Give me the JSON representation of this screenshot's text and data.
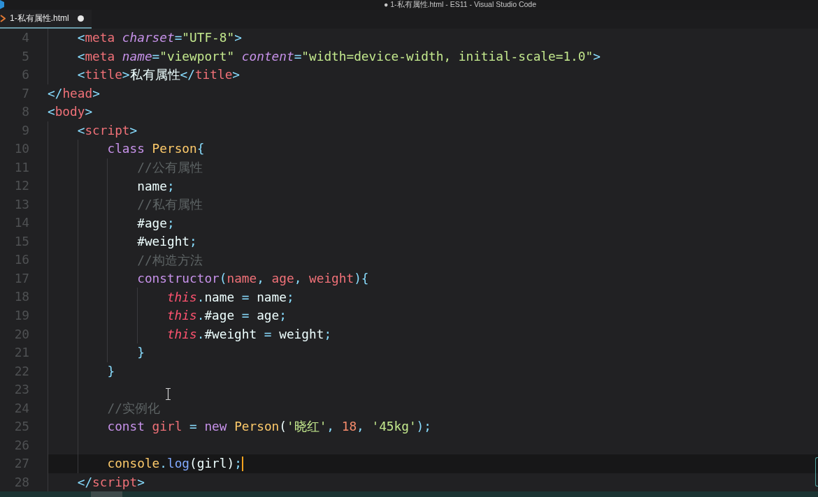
{
  "window": {
    "title": "● 1-私有属性.html - ES11 - Visual Studio Code"
  },
  "tab": {
    "label": "1-私有属性.html",
    "selected": true,
    "modified": true
  },
  "editor": {
    "lines": [
      {
        "children": [
          {
            "number": "4",
            "active": false,
            "tokens": [
              {
                "text": "<",
                "kind": "punct"
              },
              {
                "text": "meta ",
                "kind": "tag"
              },
              {
                "text": "charset",
                "kind": "attr"
              },
              {
                "text": "=",
                "kind": "punct"
              },
              {
                "text": "\"UTF-8\"",
                "kind": "string"
              },
              {
                "text": ">",
                "kind": "punct"
              }
            ]
          },
          {
            "number": "5",
            "active": false,
            "tokens": [
              {
                "text": "<",
                "kind": "punct"
              },
              {
                "text": "meta ",
                "kind": "tag"
              },
              {
                "text": "name",
                "kind": "attr"
              },
              {
                "text": "=",
                "kind": "punct"
              },
              {
                "text": "\"viewport\" ",
                "kind": "string"
              },
              {
                "text": "content",
                "kind": "attr"
              },
              {
                "text": "=",
                "kind": "punct"
              },
              {
                "text": "\"width=device-width, initial-scale=1.0\"",
                "kind": "string"
              },
              {
                "text": ">",
                "kind": "punct"
              }
            ]
          },
          {
            "number": "6",
            "active": false,
            "tokens": [
              {
                "text": "<",
                "kind": "punct"
              },
              {
                "text": "title",
                "kind": "tag"
              },
              {
                "text": ">",
                "kind": "punct"
              },
              {
                "text": "私有属性",
                "kind": "text"
              },
              {
                "text": "</",
                "kind": "punct"
              },
              {
                "text": "title",
                "kind": "tag"
              },
              {
                "text": ">",
                "kind": "punct"
              }
            ]
          }
        ]
      },
      {
        "number": "7",
        "active": false,
        "tokens": [
          {
            "text": "</",
            "kind": "punct"
          },
          {
            "text": "head",
            "kind": "tag"
          },
          {
            "text": ">",
            "kind": "punct"
          }
        ]
      },
      {
        "number": "8",
        "active": false,
        "tokens": [
          {
            "text": "<",
            "kind": "punct"
          },
          {
            "text": "body",
            "kind": "tag"
          },
          {
            "text": ">",
            "kind": "punct"
          }
        ],
        "children": [
          {
            "number": "9",
            "active": false,
            "tokens": [
              {
                "text": "<",
                "kind": "punct"
              },
              {
                "text": "script",
                "kind": "tag"
              },
              {
                "text": ">",
                "kind": "punct"
              }
            ],
            "children": [
              {
                "number": "10",
                "active": false,
                "tokens": [
                  {
                    "text": "class ",
                    "kind": "keyword"
                  },
                  {
                    "text": "Person",
                    "kind": "class"
                  },
                  {
                    "text": "{",
                    "kind": "punct"
                  }
                ],
                "children": [
                  {
                    "number": "11",
                    "active": false,
                    "tokens": [
                      {
                        "text": "//公有属性",
                        "kind": "comment"
                      }
                    ]
                  },
                  {
                    "number": "12",
                    "active": false,
                    "tokens": [
                      {
                        "text": "name",
                        "kind": "plain"
                      },
                      {
                        "text": ";",
                        "kind": "punct"
                      }
                    ]
                  },
                  {
                    "number": "13",
                    "active": false,
                    "tokens": [
                      {
                        "text": "//私有属性",
                        "kind": "comment"
                      }
                    ]
                  },
                  {
                    "number": "14",
                    "active": false,
                    "tokens": [
                      {
                        "text": "#age",
                        "kind": "plain"
                      },
                      {
                        "text": ";",
                        "kind": "punct"
                      }
                    ]
                  },
                  {
                    "number": "15",
                    "active": false,
                    "tokens": [
                      {
                        "text": "#weight",
                        "kind": "plain"
                      },
                      {
                        "text": ";",
                        "kind": "punct"
                      }
                    ]
                  },
                  {
                    "number": "16",
                    "active": false,
                    "tokens": [
                      {
                        "text": "//构造方法",
                        "kind": "comment"
                      }
                    ]
                  },
                  {
                    "number": "17",
                    "active": false,
                    "tokens": [
                      {
                        "text": "constructor",
                        "kind": "func"
                      },
                      {
                        "text": "(",
                        "kind": "punct"
                      },
                      {
                        "text": "name",
                        "kind": "param"
                      },
                      {
                        "text": ", ",
                        "kind": "punct"
                      },
                      {
                        "text": "age",
                        "kind": "param"
                      },
                      {
                        "text": ", ",
                        "kind": "punct"
                      },
                      {
                        "text": "weight",
                        "kind": "param"
                      },
                      {
                        "text": "){",
                        "kind": "punct"
                      }
                    ],
                    "children": [
                      {
                        "number": "18",
                        "active": false,
                        "tokens": [
                          {
                            "text": "this",
                            "kind": "this"
                          },
                          {
                            "text": ".",
                            "kind": "punct"
                          },
                          {
                            "text": "name",
                            "kind": "plain"
                          },
                          {
                            "text": " = ",
                            "kind": "punct"
                          },
                          {
                            "text": "name",
                            "kind": "plain"
                          },
                          {
                            "text": ";",
                            "kind": "punct"
                          }
                        ]
                      },
                      {
                        "number": "19",
                        "active": false,
                        "tokens": [
                          {
                            "text": "this",
                            "kind": "this"
                          },
                          {
                            "text": ".",
                            "kind": "punct"
                          },
                          {
                            "text": "#age",
                            "kind": "plain"
                          },
                          {
                            "text": " = ",
                            "kind": "punct"
                          },
                          {
                            "text": "age",
                            "kind": "plain"
                          },
                          {
                            "text": ";",
                            "kind": "punct"
                          }
                        ]
                      },
                      {
                        "number": "20",
                        "active": false,
                        "tokens": [
                          {
                            "text": "this",
                            "kind": "this"
                          },
                          {
                            "text": ".",
                            "kind": "punct"
                          },
                          {
                            "text": "#weight",
                            "kind": "plain"
                          },
                          {
                            "text": " = ",
                            "kind": "punct"
                          },
                          {
                            "text": "weight",
                            "kind": "plain"
                          },
                          {
                            "text": ";",
                            "kind": "punct"
                          }
                        ]
                      }
                    ]
                  },
                  {
                    "number": "21",
                    "active": false,
                    "tokens": [
                      {
                        "text": "}",
                        "kind": "punct"
                      }
                    ]
                  }
                ]
              },
              {
                "number": "22",
                "active": false,
                "tokens": [
                  {
                    "text": "}",
                    "kind": "punct"
                  }
                ]
              },
              {
                "number": "23",
                "active": false
              },
              {
                "number": "24",
                "active": false,
                "tokens": [
                  {
                    "text": "//实例化",
                    "kind": "comment"
                  }
                ]
              },
              {
                "number": "25",
                "active": false,
                "tokens": [
                  {
                    "text": "const ",
                    "kind": "keyword"
                  },
                  {
                    "text": "girl",
                    "kind": "param"
                  },
                  {
                    "text": " = ",
                    "kind": "punct"
                  },
                  {
                    "text": "new ",
                    "kind": "keyword"
                  },
                  {
                    "text": "Person",
                    "kind": "class"
                  },
                  {
                    "text": "(",
                    "kind": "plain"
                  },
                  {
                    "text": "'晓红'",
                    "kind": "string"
                  },
                  {
                    "text": ", ",
                    "kind": "punct"
                  },
                  {
                    "text": "18",
                    "kind": "number"
                  },
                  {
                    "text": ", ",
                    "kind": "punct"
                  },
                  {
                    "text": "'45kg'",
                    "kind": "string"
                  },
                  {
                    "text": ");",
                    "kind": "punct"
                  }
                ]
              },
              {
                "number": "26",
                "active": false
              },
              {
                "number": "27",
                "active": true,
                "tokens": [
                  {
                    "text": "console",
                    "kind": "class"
                  },
                  {
                    "text": ".",
                    "kind": "punct"
                  },
                  {
                    "text": "log",
                    "kind": "method"
                  },
                  {
                    "text": "(girl)",
                    "kind": "plain"
                  },
                  {
                    "text": ";",
                    "kind": "punct"
                  }
                ]
              }
            ]
          },
          {
            "number": "28",
            "active": false,
            "tokens": [
              {
                "text": "</",
                "kind": "punct"
              },
              {
                "text": "script",
                "kind": "tag"
              },
              {
                "text": ">",
                "kind": "punct"
              }
            ]
          }
        ]
      }
    ]
  },
  "mouse_pointer": {
    "kind": "i-beam"
  }
}
